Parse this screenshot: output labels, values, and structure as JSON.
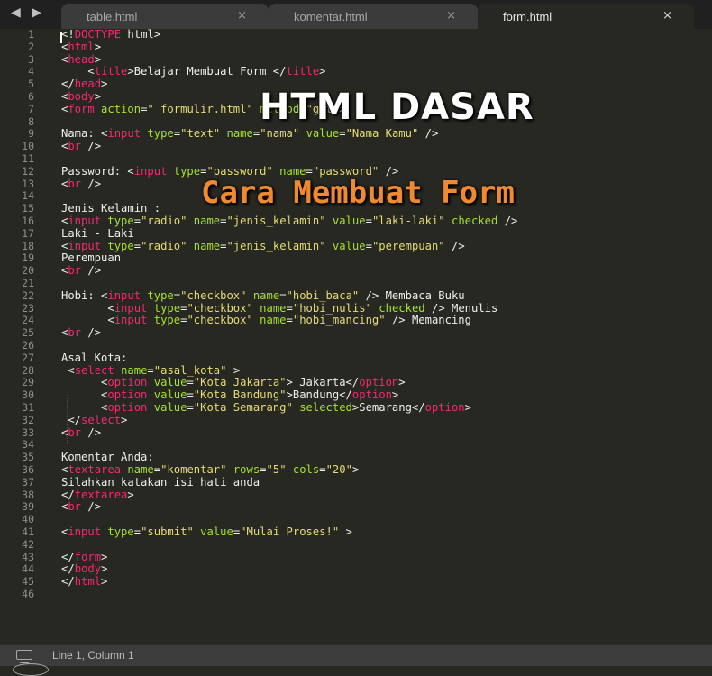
{
  "tabs": [
    {
      "label": "table.html",
      "close": "×"
    },
    {
      "label": "komentar.html",
      "close": "×"
    },
    {
      "label": "form.html",
      "close": "×"
    }
  ],
  "nav": {
    "arrows": "◀ ▶"
  },
  "overlay": {
    "title": "HTML DASAR",
    "subtitle": "Cara Membuat Form",
    "title_color": "#ffffff",
    "subtitle_color": "#f08a30"
  },
  "theme": {
    "tag": "#f92672",
    "attr": "#a6e22e",
    "string": "#e6db74",
    "text": "#f0f0ea",
    "background": "#272822"
  },
  "code_lines": [
    [
      [
        "t",
        "<!"
      ],
      [
        "g",
        "DOCTYPE"
      ],
      [
        "t",
        " html>"
      ]
    ],
    [
      [
        "t",
        "<"
      ],
      [
        "g",
        "html"
      ],
      [
        "t",
        ">"
      ]
    ],
    [
      [
        "t",
        "<"
      ],
      [
        "g",
        "head"
      ],
      [
        "t",
        ">"
      ]
    ],
    [
      [
        "t",
        "    <"
      ],
      [
        "g",
        "title"
      ],
      [
        "t",
        ">Belajar Membuat Form </"
      ],
      [
        "g",
        "title"
      ],
      [
        "t",
        ">"
      ]
    ],
    [
      [
        "t",
        "</"
      ],
      [
        "g",
        "head"
      ],
      [
        "t",
        ">"
      ]
    ],
    [
      [
        "t",
        "<"
      ],
      [
        "g",
        "body"
      ],
      [
        "t",
        ">"
      ]
    ],
    [
      [
        "t",
        "<"
      ],
      [
        "g",
        "form"
      ],
      [
        "t",
        " "
      ],
      [
        "a",
        "action"
      ],
      [
        "t",
        "="
      ],
      [
        "s",
        "\" formulir.html\""
      ],
      [
        "t",
        " "
      ],
      [
        "a",
        "method"
      ],
      [
        "t",
        "="
      ],
      [
        "s",
        "\"get\""
      ],
      [
        "t",
        ">"
      ]
    ],
    [],
    [
      [
        "t",
        "Nama: <"
      ],
      [
        "g",
        "input"
      ],
      [
        "t",
        " "
      ],
      [
        "a",
        "type"
      ],
      [
        "t",
        "="
      ],
      [
        "s",
        "\"text\""
      ],
      [
        "t",
        " "
      ],
      [
        "a",
        "name"
      ],
      [
        "t",
        "="
      ],
      [
        "s",
        "\"nama\""
      ],
      [
        "t",
        " "
      ],
      [
        "a",
        "value"
      ],
      [
        "t",
        "="
      ],
      [
        "s",
        "\"Nama Kamu\""
      ],
      [
        "t",
        " />"
      ]
    ],
    [
      [
        "t",
        "<"
      ],
      [
        "g",
        "br"
      ],
      [
        "t",
        " />"
      ]
    ],
    [],
    [
      [
        "t",
        "Password: <"
      ],
      [
        "g",
        "input"
      ],
      [
        "t",
        " "
      ],
      [
        "a",
        "type"
      ],
      [
        "t",
        "="
      ],
      [
        "s",
        "\"password\""
      ],
      [
        "t",
        " "
      ],
      [
        "a",
        "name"
      ],
      [
        "t",
        "="
      ],
      [
        "s",
        "\"password\""
      ],
      [
        "t",
        " />"
      ]
    ],
    [
      [
        "t",
        "<"
      ],
      [
        "g",
        "br"
      ],
      [
        "t",
        " />"
      ]
    ],
    [],
    [
      [
        "t",
        "Jenis Kelamin :"
      ]
    ],
    [
      [
        "t",
        "<"
      ],
      [
        "g",
        "input"
      ],
      [
        "t",
        " "
      ],
      [
        "a",
        "type"
      ],
      [
        "t",
        "="
      ],
      [
        "s",
        "\"radio\""
      ],
      [
        "t",
        " "
      ],
      [
        "a",
        "name"
      ],
      [
        "t",
        "="
      ],
      [
        "s",
        "\"jenis_kelamin\""
      ],
      [
        "t",
        " "
      ],
      [
        "a",
        "value"
      ],
      [
        "t",
        "="
      ],
      [
        "s",
        "\"laki-laki\""
      ],
      [
        "t",
        " "
      ],
      [
        "a",
        "checked"
      ],
      [
        "t",
        " />"
      ]
    ],
    [
      [
        "t",
        "Laki - Laki"
      ]
    ],
    [
      [
        "t",
        "<"
      ],
      [
        "g",
        "input"
      ],
      [
        "t",
        " "
      ],
      [
        "a",
        "type"
      ],
      [
        "t",
        "="
      ],
      [
        "s",
        "\"radio\""
      ],
      [
        "t",
        " "
      ],
      [
        "a",
        "name"
      ],
      [
        "t",
        "="
      ],
      [
        "s",
        "\"jenis_kelamin\""
      ],
      [
        "t",
        " "
      ],
      [
        "a",
        "value"
      ],
      [
        "t",
        "="
      ],
      [
        "s",
        "\"perempuan\""
      ],
      [
        "t",
        " />"
      ]
    ],
    [
      [
        "t",
        "Perempuan"
      ]
    ],
    [
      [
        "t",
        "<"
      ],
      [
        "g",
        "br"
      ],
      [
        "t",
        " />"
      ]
    ],
    [],
    [
      [
        "t",
        "Hobi: <"
      ],
      [
        "g",
        "input"
      ],
      [
        "t",
        " "
      ],
      [
        "a",
        "type"
      ],
      [
        "t",
        "="
      ],
      [
        "s",
        "\"checkbox\""
      ],
      [
        "t",
        " "
      ],
      [
        "a",
        "name"
      ],
      [
        "t",
        "="
      ],
      [
        "s",
        "\"hobi_baca\""
      ],
      [
        "t",
        " /> Membaca Buku"
      ]
    ],
    [
      [
        "t",
        "       <"
      ],
      [
        "g",
        "input"
      ],
      [
        "t",
        " "
      ],
      [
        "a",
        "type"
      ],
      [
        "t",
        "="
      ],
      [
        "s",
        "\"checkbox\""
      ],
      [
        "t",
        " "
      ],
      [
        "a",
        "name"
      ],
      [
        "t",
        "="
      ],
      [
        "s",
        "\"hobi_nulis\""
      ],
      [
        "t",
        " "
      ],
      [
        "a",
        "checked"
      ],
      [
        "t",
        " /> Menulis"
      ]
    ],
    [
      [
        "t",
        "       <"
      ],
      [
        "g",
        "input"
      ],
      [
        "t",
        " "
      ],
      [
        "a",
        "type"
      ],
      [
        "t",
        "="
      ],
      [
        "s",
        "\"checkbox\""
      ],
      [
        "t",
        " "
      ],
      [
        "a",
        "name"
      ],
      [
        "t",
        "="
      ],
      [
        "s",
        "\"hobi_mancing\""
      ],
      [
        "t",
        " /> Memancing"
      ]
    ],
    [
      [
        "t",
        "<"
      ],
      [
        "g",
        "br"
      ],
      [
        "t",
        " />"
      ]
    ],
    [],
    [
      [
        "t",
        "Asal Kota:"
      ]
    ],
    [
      [
        "t",
        " <"
      ],
      [
        "g",
        "select"
      ],
      [
        "t",
        " "
      ],
      [
        "a",
        "name"
      ],
      [
        "t",
        "="
      ],
      [
        "s",
        "\"asal_kota\""
      ],
      [
        "t",
        " >"
      ]
    ],
    [
      [
        "t",
        "      <"
      ],
      [
        "g",
        "option"
      ],
      [
        "t",
        " "
      ],
      [
        "a",
        "value"
      ],
      [
        "t",
        "="
      ],
      [
        "s",
        "\"Kota Jakarta\""
      ],
      [
        "t",
        "> Jakarta</"
      ],
      [
        "g",
        "option"
      ],
      [
        "t",
        ">"
      ]
    ],
    [
      [
        "t",
        "      <"
      ],
      [
        "g",
        "option"
      ],
      [
        "t",
        " "
      ],
      [
        "a",
        "value"
      ],
      [
        "t",
        "="
      ],
      [
        "s",
        "\"Kota Bandung\""
      ],
      [
        "t",
        ">Bandung</"
      ],
      [
        "g",
        "option"
      ],
      [
        "t",
        ">"
      ]
    ],
    [
      [
        "t",
        "      <"
      ],
      [
        "g",
        "option"
      ],
      [
        "t",
        " "
      ],
      [
        "a",
        "value"
      ],
      [
        "t",
        "="
      ],
      [
        "s",
        "\"Kota Semarang\""
      ],
      [
        "t",
        " "
      ],
      [
        "a",
        "selected"
      ],
      [
        "t",
        ">Semarang</"
      ],
      [
        "g",
        "option"
      ],
      [
        "t",
        ">"
      ]
    ],
    [
      [
        "t",
        " </"
      ],
      [
        "g",
        "select"
      ],
      [
        "t",
        ">"
      ]
    ],
    [
      [
        "t",
        "<"
      ],
      [
        "g",
        "br"
      ],
      [
        "t",
        " />"
      ]
    ],
    [],
    [
      [
        "t",
        "Komentar Anda:"
      ]
    ],
    [
      [
        "t",
        "<"
      ],
      [
        "g",
        "textarea"
      ],
      [
        "t",
        " "
      ],
      [
        "a",
        "name"
      ],
      [
        "t",
        "="
      ],
      [
        "s",
        "\"komentar\""
      ],
      [
        "t",
        " "
      ],
      [
        "a",
        "rows"
      ],
      [
        "t",
        "="
      ],
      [
        "s",
        "\"5\""
      ],
      [
        "t",
        " "
      ],
      [
        "a",
        "cols"
      ],
      [
        "t",
        "="
      ],
      [
        "s",
        "\"20\""
      ],
      [
        "t",
        ">"
      ]
    ],
    [
      [
        "t",
        "Silahkan katakan isi hati anda"
      ]
    ],
    [
      [
        "t",
        "</"
      ],
      [
        "g",
        "textarea"
      ],
      [
        "t",
        ">"
      ]
    ],
    [
      [
        "t",
        "<"
      ],
      [
        "g",
        "br"
      ],
      [
        "t",
        " />"
      ]
    ],
    [],
    [
      [
        "t",
        "<"
      ],
      [
        "g",
        "input"
      ],
      [
        "t",
        " "
      ],
      [
        "a",
        "type"
      ],
      [
        "t",
        "="
      ],
      [
        "s",
        "\"submit\""
      ],
      [
        "t",
        " "
      ],
      [
        "a",
        "value"
      ],
      [
        "t",
        "="
      ],
      [
        "s",
        "\"Mulai Proses!\""
      ],
      [
        "t",
        " >"
      ]
    ],
    [],
    [
      [
        "t",
        "</"
      ],
      [
        "g",
        "form"
      ],
      [
        "t",
        ">"
      ]
    ],
    [
      [
        "t",
        "</"
      ],
      [
        "g",
        "body"
      ],
      [
        "t",
        ">"
      ]
    ],
    [
      [
        "t",
        "</"
      ],
      [
        "g",
        "html"
      ],
      [
        "t",
        ">"
      ]
    ],
    []
  ],
  "status": {
    "position": "Line 1, Column 1"
  }
}
